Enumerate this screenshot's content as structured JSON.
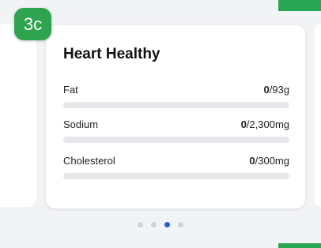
{
  "badge": {
    "label": "3c"
  },
  "card": {
    "title": "Heart Healthy",
    "rows": [
      {
        "label": "Fat",
        "current": "0",
        "target": "/93g",
        "progress": 0
      },
      {
        "label": "Sodium",
        "current": "0",
        "target": "/2,300mg",
        "progress": 0
      },
      {
        "label": "Cholesterol",
        "current": "0",
        "target": "/300mg",
        "progress": 0
      }
    ]
  },
  "pager": {
    "count": 4,
    "active_index": 2
  },
  "colors": {
    "accent": "#2aa553",
    "active_dot": "#1f5fd6",
    "inactive_dot": "#cfd2d6"
  }
}
